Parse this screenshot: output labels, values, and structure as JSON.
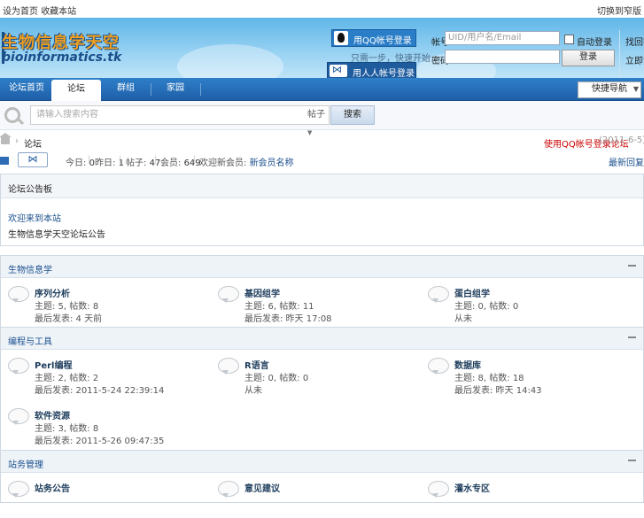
{
  "topbar": {
    "links": [
      "设为首页",
      "收藏本站"
    ],
    "right_link": "切换到窄版"
  },
  "header": {
    "logo_cn": "生物信息学天空",
    "logo_en": "bioinformatics.tk",
    "qq_login": "用QQ帐号登录",
    "qq_hint": "只需一步，快速开始",
    "renren_login": "用人人帐号登录",
    "login": {
      "username_label": "帐号",
      "username_placeholder": "UID/用户名/Email",
      "remember_label": "自动登录",
      "forgot_label": "找回密码",
      "password_label": "密码",
      "submit_label": "登录",
      "register_label": "立即注册"
    }
  },
  "nav": {
    "tabs": [
      "论坛首页",
      "论坛",
      "群组",
      "家园"
    ],
    "active": 1,
    "quick_nav": "快捷导航"
  },
  "search": {
    "placeholder": "请输入搜索内容",
    "scope": "帖子",
    "button": "搜索"
  },
  "breadcrumb": {
    "current": "论坛",
    "news": "使用QQ帐号登录论坛",
    "news_date": "(2011-6-5)"
  },
  "stats": {
    "today_label": "今日",
    "today": "0",
    "yesterday_label": "昨日",
    "yesterday": "1",
    "posts_label": "帖子",
    "posts": "47",
    "members_label": "会员",
    "members": "649",
    "newest_label": "欢迎新会员",
    "newest": "新会员名称",
    "right_link": "最新回复"
  },
  "notice": {
    "header": "论坛公告板",
    "link": "欢迎来到本站",
    "body": "生物信息学天空论坛公告"
  },
  "groups": [
    {
      "title": "生物信息学",
      "forums": [
        {
          "name": "序列分析",
          "meta": "主题: 5, 帖数: 8",
          "last": "最后发表: 4 天前"
        },
        {
          "name": "基因组学",
          "meta": "主题: 6, 帖数: 11",
          "last": "最后发表: 昨天 17:08"
        },
        {
          "name": "蛋白组学",
          "meta": "主题: 0, 帖数: 0",
          "last": "从未"
        }
      ]
    },
    {
      "title": "编程与工具",
      "forums": [
        {
          "name": "Perl编程",
          "meta": "主题: 2, 帖数: 2",
          "last": "最后发表: 2011-5-24 22:39:14"
        },
        {
          "name": "R语言",
          "meta": "主题: 0, 帖数: 0",
          "last": "从未"
        },
        {
          "name": "数据库",
          "meta": "主题: 8, 帖数: 18",
          "last": "最后发表: 昨天 14:43"
        },
        {
          "name": "软件资源",
          "meta": "主题: 3, 帖数: 8",
          "last": "最后发表: 2011-5-26 09:47:35"
        }
      ]
    },
    {
      "title": "站务管理",
      "forums": [
        {
          "name": "站务公告",
          "meta": "",
          "last": ""
        },
        {
          "name": "意见建议",
          "meta": "",
          "last": ""
        },
        {
          "name": "灌水专区",
          "meta": "",
          "last": ""
        }
      ]
    }
  ],
  "colors": {
    "nav_blue": "#1e5fa8",
    "header_sky": "#5fb6e8",
    "link_blue": "#1a4f8c",
    "news_red": "#cc0000"
  }
}
